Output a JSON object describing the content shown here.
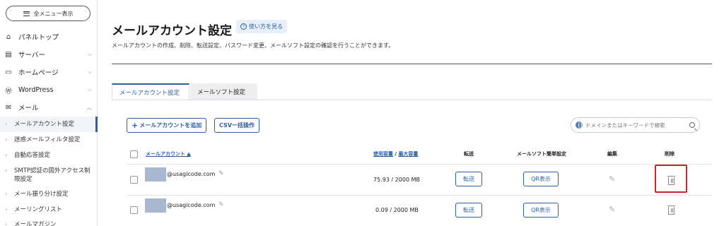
{
  "sidebar": {
    "menu_button": "全メニュー表示",
    "items": [
      {
        "label": "パネルトップ",
        "icon": "home-icon"
      },
      {
        "label": "サーバー",
        "icon": "server-icon"
      },
      {
        "label": "ホームページ",
        "icon": "window-icon"
      },
      {
        "label": "WordPress",
        "icon": "wordpress-icon"
      },
      {
        "label": "メール",
        "icon": "mail-icon"
      }
    ],
    "sub_items": [
      {
        "label": "メールアカウント設定",
        "active": true
      },
      {
        "label": "迷惑メールフィルタ設定"
      },
      {
        "label": "自動応答設定"
      },
      {
        "label": "SMTP認証の国外アクセス制限設定"
      },
      {
        "label": "メール振り分け設定"
      },
      {
        "label": "メーリングリスト"
      },
      {
        "label": "メールマガジン"
      }
    ]
  },
  "main": {
    "title": "メールアカウント設定",
    "help_label": "使い方を見る",
    "description": "メールアカウントの作成、削除、転送設定、パスワード変更、メールソフト設定の確認を行うことができます。",
    "tabs": [
      {
        "label": "メールアカウント設定",
        "active": true
      },
      {
        "label": "メールソフト設定"
      }
    ],
    "add_button": "メールアカウントを追加",
    "csv_button": "CSV一括操作",
    "search": {
      "placeholder": "ドメインまたはキーワードで検索"
    },
    "table": {
      "headers": {
        "account": "メールアカウント ▲",
        "usage_used": "使用容量",
        "usage_sep": " / ",
        "usage_max": "最大容量",
        "forward": "転送",
        "mailsoft": "メールソフト簡単設定",
        "edit": "編集",
        "delete": "削除"
      },
      "rows": [
        {
          "email": "@usagicode.com",
          "usage": "75.93 / 2000 MB",
          "forward": "転送",
          "qr": "QR表示"
        },
        {
          "email": "@usagicode.com",
          "usage": "0.09 / 2000 MB",
          "forward": "転送",
          "qr": "QR表示"
        }
      ]
    }
  },
  "colors": {
    "accent": "#2d5fa0",
    "highlight": "#c62828"
  }
}
